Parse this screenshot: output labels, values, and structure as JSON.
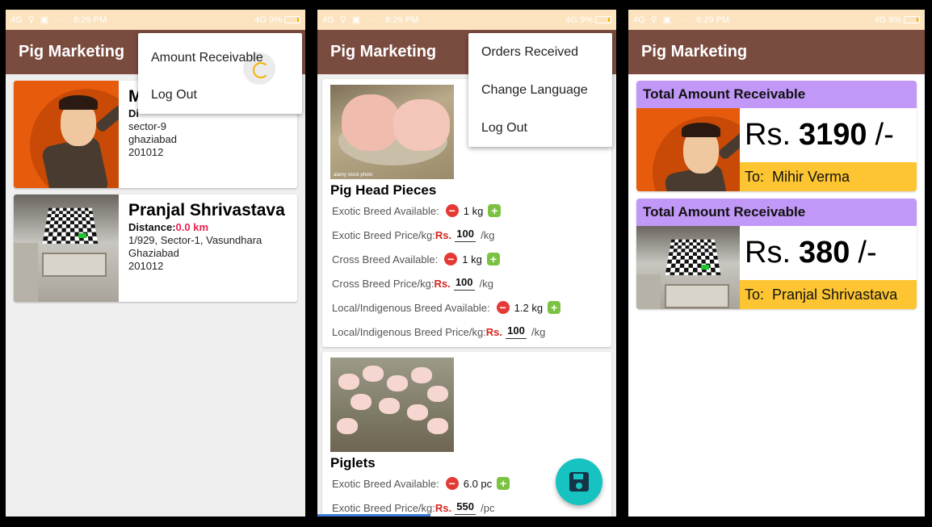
{
  "status_bar": {
    "network": "4G",
    "time": "6:29 PM",
    "right_network": "4G",
    "battery": "9%"
  },
  "app": {
    "title": "Pig Marketing"
  },
  "screen1": {
    "menu": [
      "Amount Receivable",
      "Log Out"
    ],
    "farms": [
      {
        "name": "M",
        "distance_prefix": "Di",
        "address": [
          "sector-9",
          "ghaziabad",
          "201012"
        ],
        "image": "mr-bean-cartoon"
      },
      {
        "name": "Pranjal Shrivastava",
        "distance_label": "Distance:",
        "distance_value": "0.0 km",
        "address": [
          "1/929, Sector-1, Vasundhara",
          "Ghaziabad",
          "201012"
        ],
        "image": "room-photo"
      }
    ]
  },
  "screen2": {
    "menu": [
      "Orders Received",
      "Change Language",
      "Log Out"
    ],
    "products": [
      {
        "title": "Pig Head Pieces",
        "image": "pig-head-photo",
        "watermark": "alamy stock photo",
        "rows": [
          {
            "type": "qty",
            "label": "Exotic Breed Available:",
            "value": "1 kg"
          },
          {
            "type": "price",
            "label": "Exotic Breed Price/kg:",
            "currency": "Rs.",
            "value": "100",
            "unit": "/kg"
          },
          {
            "type": "qty",
            "label": "Cross Breed Available:",
            "value": "1 kg"
          },
          {
            "type": "price",
            "label": "Cross Breed Price/kg:",
            "currency": "Rs.",
            "value": "100",
            "unit": "/kg"
          },
          {
            "type": "qty",
            "label": "Local/Indigenous Breed Available:",
            "value": "1.2 kg"
          },
          {
            "type": "price",
            "label": "Local/Indigenous Breed Price/kg:",
            "currency": "Rs.",
            "value": "100",
            "unit": "/kg"
          }
        ]
      },
      {
        "title": "Piglets",
        "image": "piglets-photo",
        "rows": [
          {
            "type": "qty",
            "label": "Exotic Breed Available:",
            "value": "6.0 pc"
          },
          {
            "type": "price",
            "label": "Exotic Breed Price/kg:",
            "currency": "Rs.",
            "value": "550",
            "unit": "/pc"
          }
        ]
      }
    ],
    "fab_icon": "save-icon"
  },
  "screen3": {
    "cards": [
      {
        "header": "Total Amount Receivable",
        "currency": "Rs.",
        "amount": "3190",
        "suffix": "/-",
        "to_label": "To:",
        "to_name": "Mihir Verma",
        "image": "mr-bean-cartoon"
      },
      {
        "header": "Total Amount Receivable",
        "currency": "Rs.",
        "amount": "380",
        "suffix": "/-",
        "to_label": "To:",
        "to_name": "Pranjal Shrivastava",
        "image": "room-photo"
      }
    ]
  },
  "colors": {
    "appbar": "#7a4b3f",
    "statusbar": "#fbe3c0",
    "card_header": "#c198f7",
    "to_bar": "#fcc531",
    "fab": "#16c3c0",
    "distance_accent": "#e5204f",
    "price_currency": "#d6271f"
  }
}
